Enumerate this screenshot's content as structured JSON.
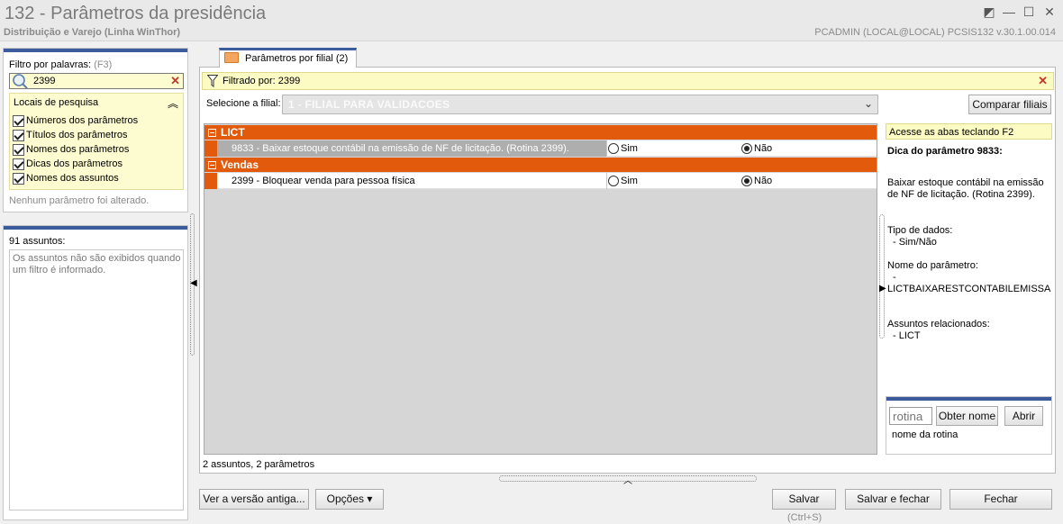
{
  "window": {
    "title": "132 - Parâmetros da presidência",
    "subtitle": "Distribuição e Varejo (Linha WinThor)",
    "info": "PCADMIN (LOCAL@LOCAL)   PCSIS132  v.30.1.00.014"
  },
  "filter": {
    "label": "Filtro por palavras:",
    "shortcut": "(F3)",
    "value": "2399",
    "locations_title": "Locais de pesquisa",
    "locations": [
      {
        "label": "Números dos parâmetros",
        "checked": true
      },
      {
        "label": "Títulos dos parâmetros",
        "checked": true
      },
      {
        "label": "Nomes dos parâmetros",
        "checked": true
      },
      {
        "label": "Dicas dos parâmetros",
        "checked": true
      },
      {
        "label": "Nomes dos assuntos",
        "checked": true
      }
    ],
    "no_change": "Nenhum parâmetro foi alterado."
  },
  "subjects": {
    "count": "91 assuntos:",
    "message": "Os assuntos não são exibidos quando um filtro é informado."
  },
  "tab": {
    "label": "Parâmetros por filial",
    "count": "(2)"
  },
  "filter_bar": {
    "text": "Filtrado por: 2399"
  },
  "branch": {
    "label": "Selecione a filial:",
    "value": "1 - FILIAL PARA VALIDACOES",
    "compare_label": "Comparar filiais"
  },
  "grid": {
    "groups": [
      {
        "name": "LICT",
        "rows": [
          {
            "text": "9833 - Baixar estoque contábil na emissão de NF de licitação. (Rotina 2399).",
            "yes": "Sim",
            "no": "Não",
            "selected_value": "Não",
            "selected": true
          }
        ]
      },
      {
        "name": "Vendas",
        "rows": [
          {
            "text": "2399 - Bloquear venda para pessoa física",
            "yes": "Sim",
            "no": "Não",
            "selected_value": "Não",
            "selected": false
          }
        ]
      }
    ]
  },
  "status": "2 assuntos, 2 parâmetros",
  "tip": {
    "hint": "Acesse as abas teclando F2",
    "title": "Dica do parâmetro 9833:",
    "description": "Baixar estoque contábil na emissão de NF de licitação. (Rotina 2399).",
    "type_label": "Tipo de dados:",
    "type_value": "- Sim/Não",
    "name_label": "Nome do parâmetro:",
    "name_dash": "-",
    "name_value": "LICTBAIXARESTCONTABILEMISSAONF",
    "related_label": "Assuntos relacionados:",
    "related_value": "- LICT"
  },
  "routine": {
    "placeholder": "rotina",
    "get_name_label": "Obter nome",
    "open_label": "Abrir",
    "name_text": "nome da rotina"
  },
  "buttons": {
    "old_version": "Ver a versão antiga...",
    "options": "Opções ▾",
    "save": "Salvar",
    "save_shortcut": "(Ctrl+S)",
    "save_close": "Salvar e fechar",
    "close": "Fechar"
  }
}
